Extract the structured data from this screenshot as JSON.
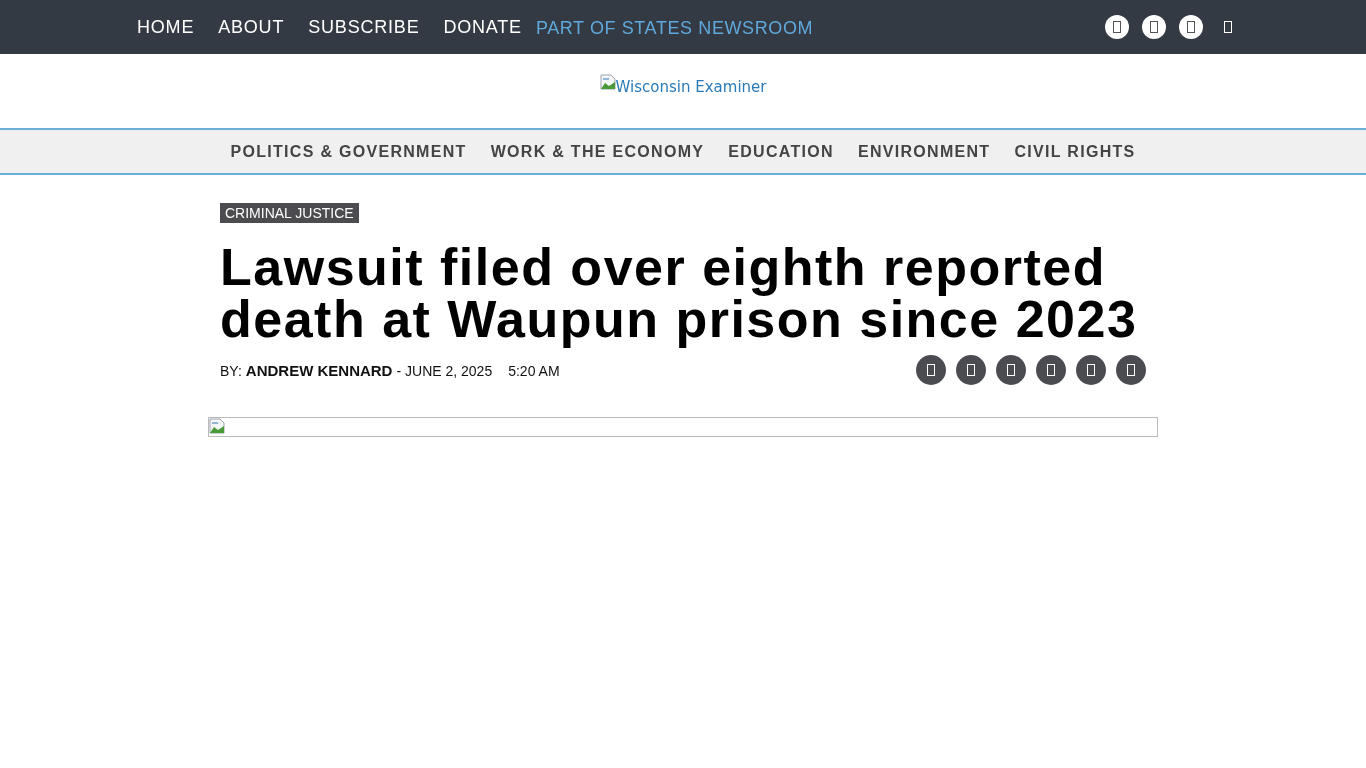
{
  "top_nav": {
    "links": [
      "HOME",
      "ABOUT",
      "SUBSCRIBE",
      "DONATE"
    ],
    "network_link": "PART OF STATES NEWSROOM"
  },
  "logo": {
    "alt_text": "Wisconsin Examiner"
  },
  "sections": [
    "POLITICS & GOVERNMENT",
    "WORK & THE ECONOMY",
    "EDUCATION",
    "ENVIRONMENT",
    "CIVIL RIGHTS"
  ],
  "article": {
    "category": "CRIMINAL JUSTICE",
    "headline": "Lawsuit filed over eighth reported death at Waupun prison since 2023",
    "byline_prefix": "BY:",
    "author": "ANDREW KENNARD",
    "date": "- JUNE 2, 2025",
    "time": "5:20 AM"
  }
}
